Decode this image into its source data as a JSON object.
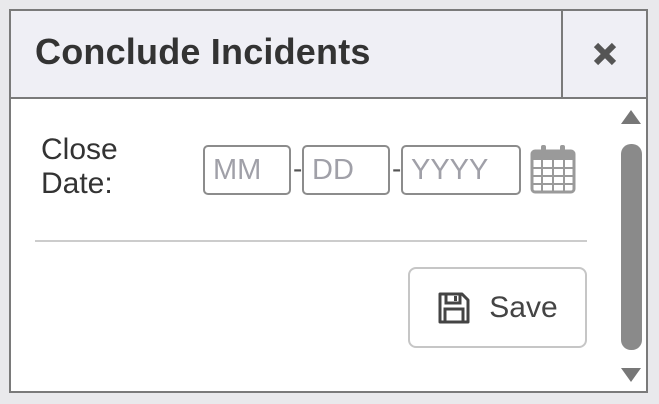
{
  "dialog": {
    "title": "Conclude Incidents",
    "close_icon": "close-icon"
  },
  "form": {
    "close_date_label": "Close Date:",
    "month_placeholder": "MM",
    "day_placeholder": "DD",
    "year_placeholder": "YYYY",
    "separator": "-",
    "calendar_icon": "calendar-icon"
  },
  "actions": {
    "save_label": "Save",
    "save_icon": "floppy-disk-icon"
  },
  "colors": {
    "title_bar_bg": "#efeff5",
    "border": "#7a7a7a",
    "scroll_thumb": "#8a8a8a",
    "text": "#333333"
  }
}
